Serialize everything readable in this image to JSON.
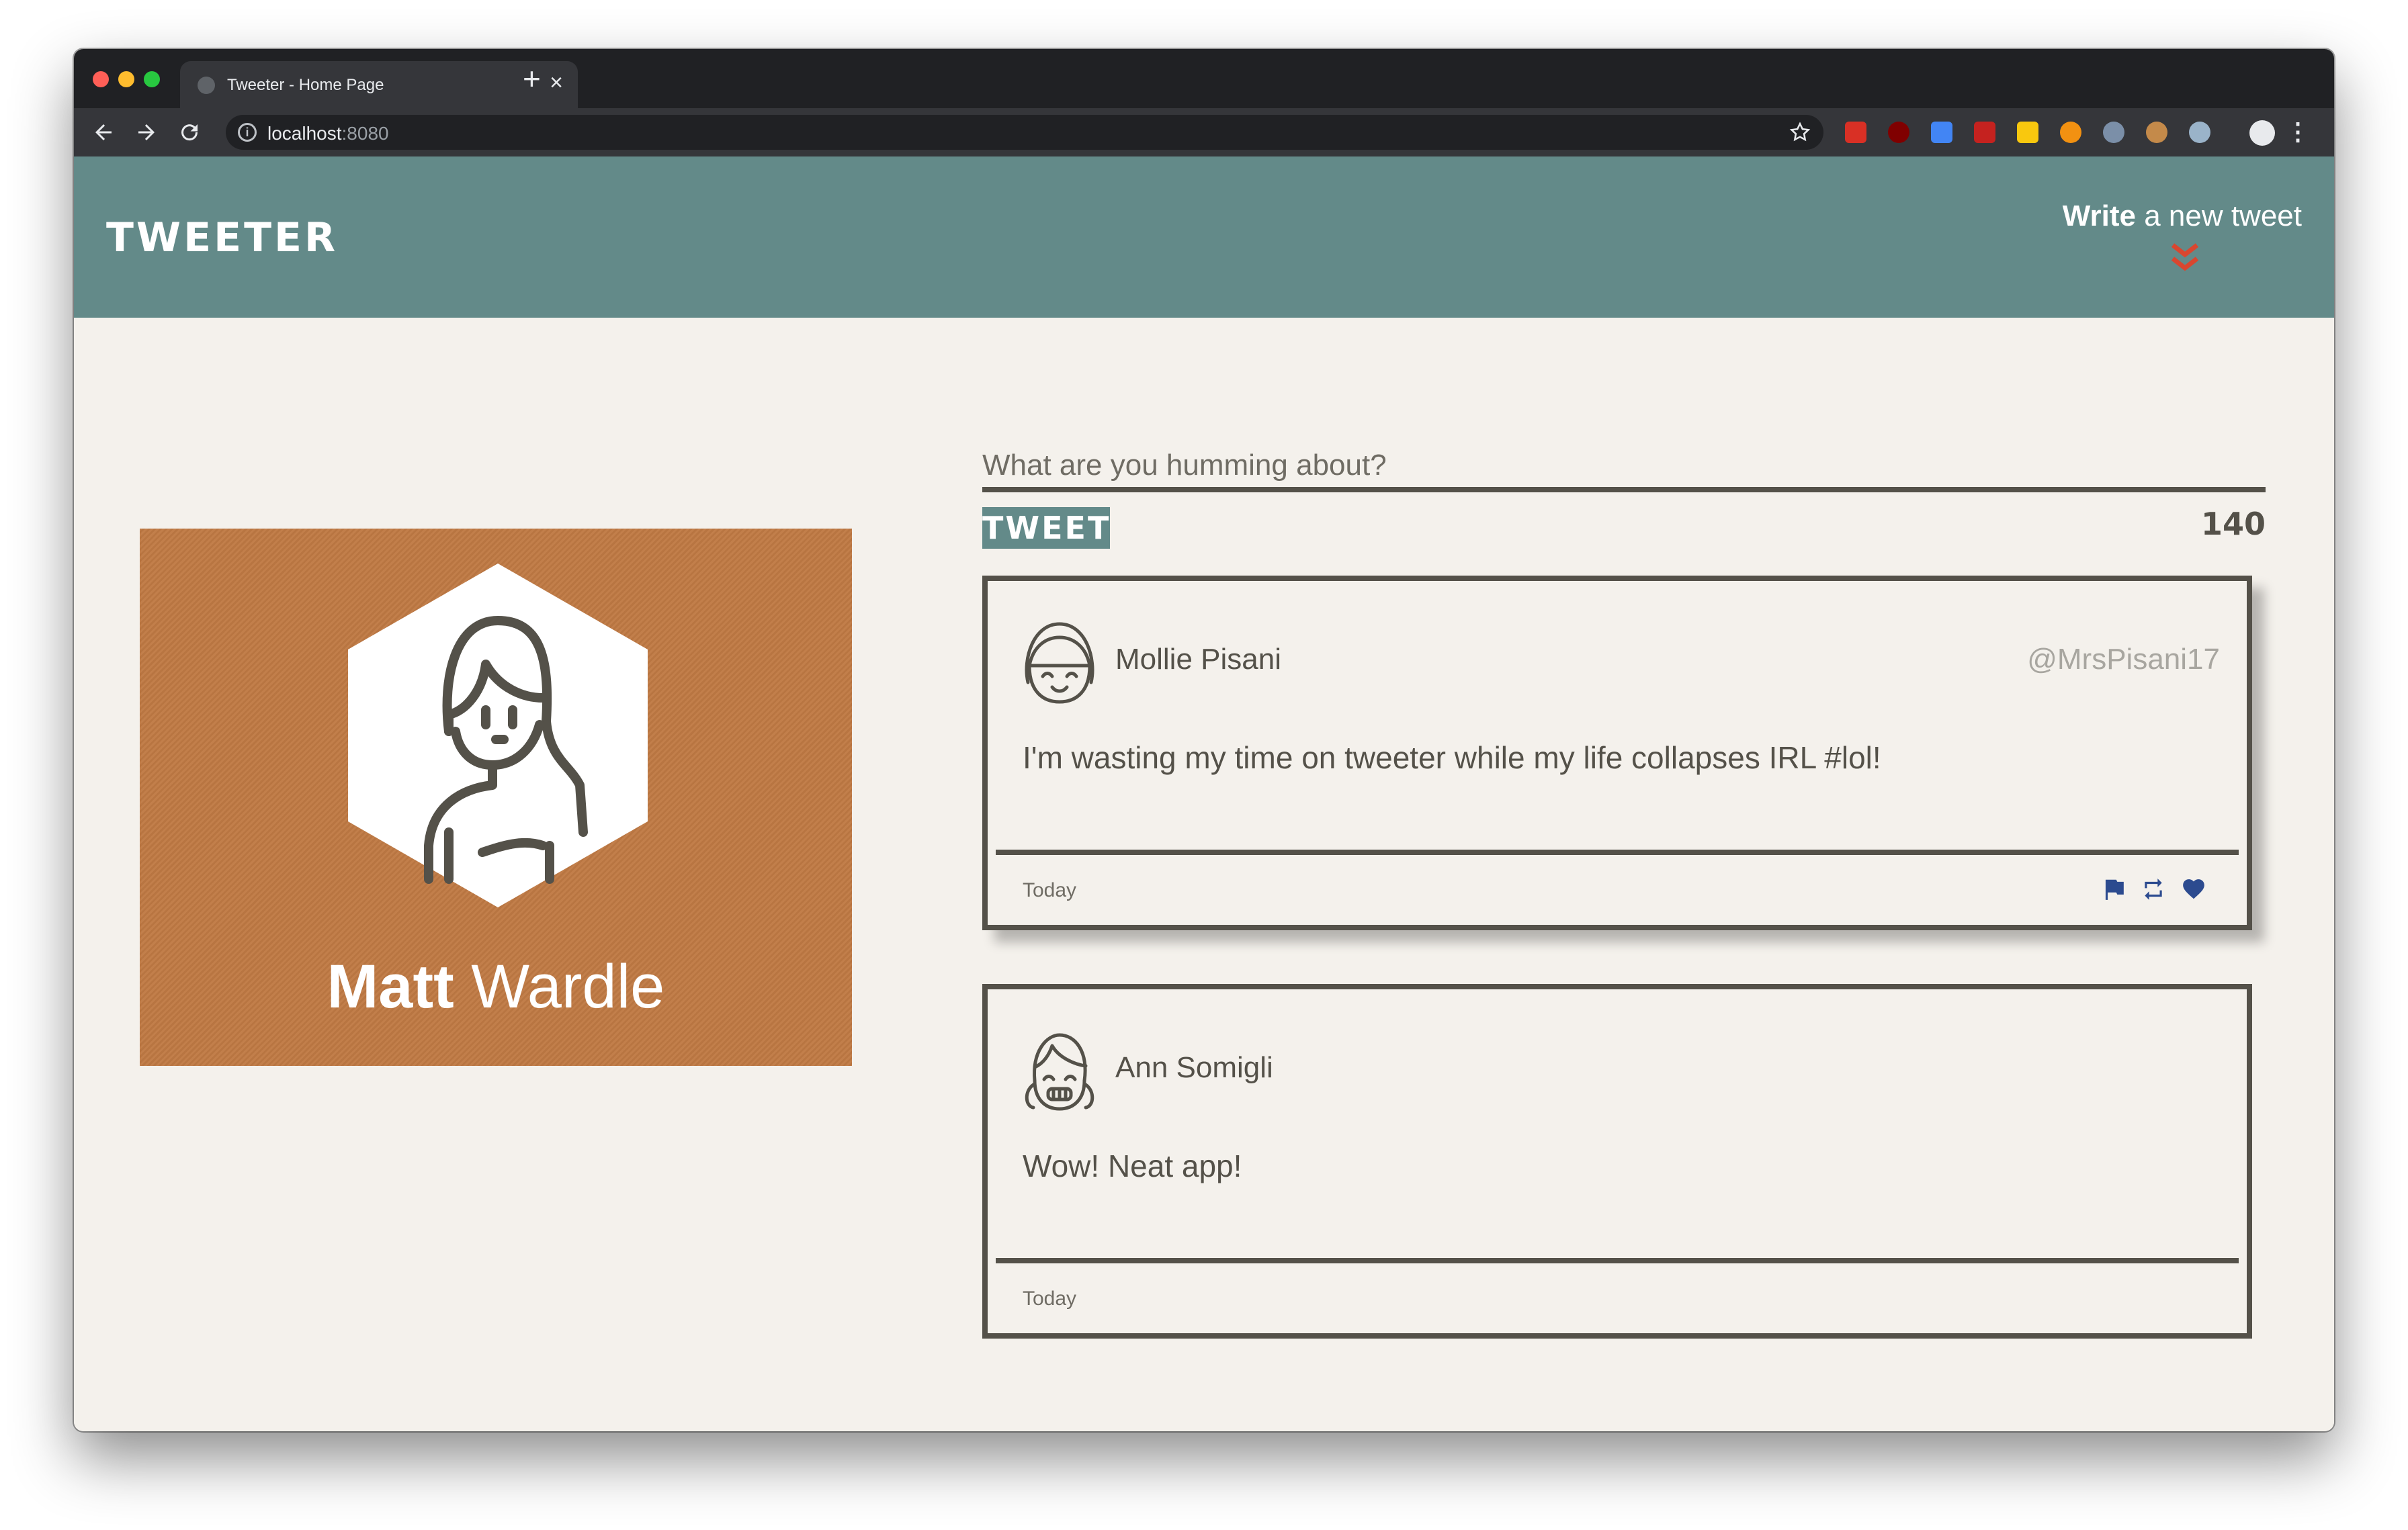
{
  "browser": {
    "tab_title": "Tweeter - Home Page",
    "close_glyph": "×",
    "new_tab_glyph": "+",
    "url_host": "localhost",
    "url_port": ":8080"
  },
  "navbar": {
    "brand": "TWEETER",
    "compose_bold": "Write",
    "compose_rest": " a new tweet"
  },
  "profile": {
    "first_name": "Matt",
    "last_name": " Wardle"
  },
  "composer": {
    "placeholder": "What are you humming about?",
    "submit_label": "TWEET",
    "char_counter": "140"
  },
  "tweets": [
    {
      "name": "Mollie Pisani",
      "handle": "@MrsPisani17",
      "text": "I'm wasting my time on tweeter while my life collapses IRL #lol!",
      "date": "Today",
      "actions": [
        "flag-icon",
        "retweet-icon",
        "heart-icon"
      ]
    },
    {
      "name": "Ann Somigli",
      "text": "Wow! Neat app!",
      "date": "Today"
    }
  ],
  "colors": {
    "navbar": "#638a89",
    "page_bg": "#f4f1ec",
    "ink": "#545149",
    "profile_card": "#c07a44",
    "chevron_red": "#d9462f",
    "action_blue": "#2c4b8f"
  }
}
